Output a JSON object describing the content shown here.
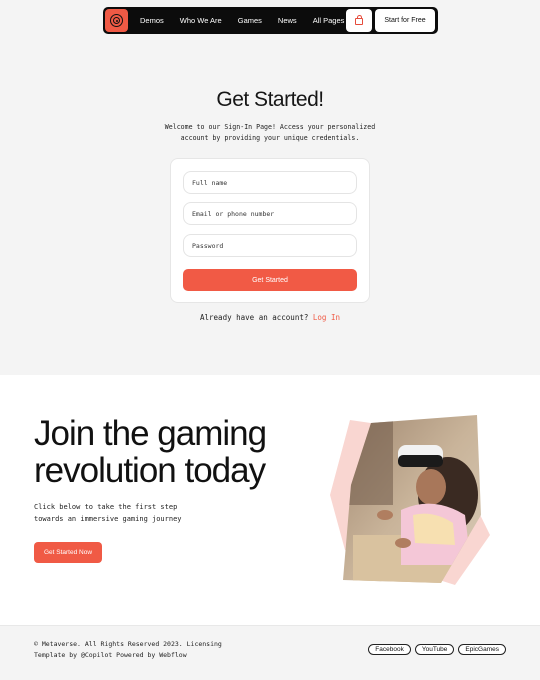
{
  "nav": {
    "links": [
      "Demos",
      "Who We Are",
      "Games",
      "News",
      "All Pages"
    ],
    "cta": "Start for Free"
  },
  "hero": {
    "title": "Get Started!",
    "subtitle_line1": "Welcome to our Sign-In Page! Access your personalized",
    "subtitle_line2": "account by providing your unique credentials.",
    "fields": {
      "full_name_placeholder": "Full name",
      "email_placeholder": "Email or phone number",
      "password_placeholder": "Password"
    },
    "submit": "Get Started",
    "already_text": "Already have an account?",
    "login_link": "Log In"
  },
  "section2": {
    "heading_line1": "Join the gaming",
    "heading_line2": "revolution today",
    "text_line1": "Click below to take the first step",
    "text_line2": "towards an immersive gaming journey",
    "button": "Get Started Now"
  },
  "footer": {
    "copy_line1": "© Metaverse. All Rights Reserved 2023. Licensing",
    "copy_line2": "Template by @Copilot Powered by Webflow",
    "socials": [
      "Facebook",
      "YouTube",
      "EpicGames"
    ]
  },
  "colors": {
    "accent": "#f05a45",
    "nav_bg": "#0c0c0c",
    "bg": "#f4f4f4"
  }
}
